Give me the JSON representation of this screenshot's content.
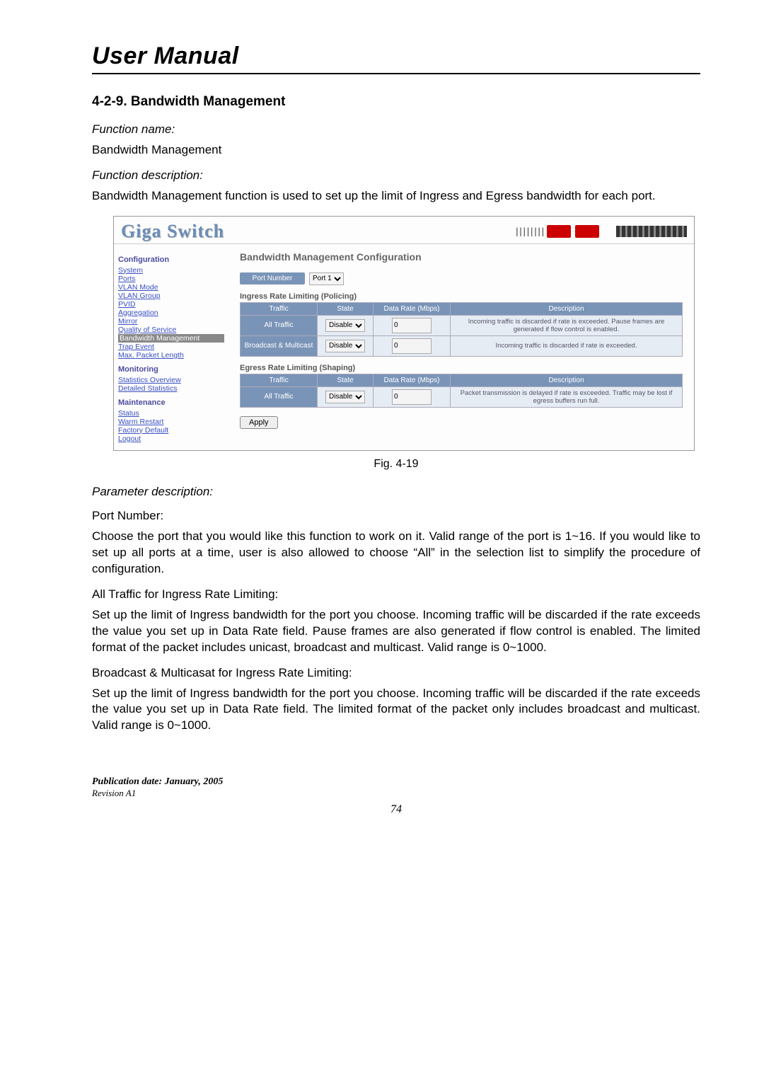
{
  "doc": {
    "title": "User Manual",
    "section_heading": "4-2-9. Bandwidth Management",
    "func_name_label": "Function name:",
    "func_name": "Bandwidth Management",
    "func_desc_label": "Function description:",
    "func_desc": "Bandwidth Management function is used to set up the limit of Ingress and Egress bandwidth for each port.",
    "fig_caption": "Fig. 4-19",
    "param_desc_label": "Parameter description:",
    "params": {
      "port_number_label": "Port Number:",
      "port_number_text": "Choose the port that you would like this function to work on it. Valid range of the port is 1~16.  If you would like to set up all ports at a time, user is also allowed to choose “All” in the selection list to simplify the procedure of configuration.",
      "ingress_all_label": "All Traffic for Ingress Rate Limiting:",
      "ingress_all_text": "Set up the limit of Ingress bandwidth for the port you choose.  Incoming traffic will be discarded if the rate exceeds the value you set up in Data Rate field. Pause frames are also generated if flow control is enabled. The limited format of the packet includes unicast, broadcast and multicast. Valid range is 0~1000.",
      "ingress_bm_label": "Broadcast & Multicasat for Ingress Rate Limiting:",
      "ingress_bm_text": "Set up the limit of Ingress bandwidth for the port you choose.  Incoming traffic will be discarded if the rate exceeds the value you set up in Data Rate field. The limited format of the packet only includes broadcast and multicast. Valid range is 0~1000."
    },
    "footer": {
      "pub": "Publication date: January, 2005",
      "rev": "Revision A1",
      "page": "74"
    }
  },
  "screenshot": {
    "logo": "Giga Switch",
    "main_title": "Bandwidth Management Configuration",
    "sidebar": {
      "config_head": "Configuration",
      "config_items": [
        "System",
        "Ports",
        "VLAN Mode",
        "VLAN Group",
        "PVID",
        "Aggregation",
        "Mirror",
        "Quality of Service",
        "Bandwidth Management",
        "Trap Event",
        "Max. Packet Length"
      ],
      "monitor_head": "Monitoring",
      "monitor_items": [
        "Statistics Overview",
        "Detailed Statistics"
      ],
      "maint_head": "Maintenance",
      "maint_items": [
        "Status",
        "Warm Restart",
        "Factory Default",
        "Logout"
      ]
    },
    "port_number_label": "Port Number",
    "port_number_value": "Port 1",
    "ingress_title": "Ingress Rate Limiting (Policing)",
    "egress_title": "Egress Rate Limiting (Shaping)",
    "headers": {
      "traffic": "Traffic",
      "state": "State",
      "rate": "Data Rate (Mbps)",
      "desc": "Description"
    },
    "ingress_rows": [
      {
        "traffic": "All Traffic",
        "state": "Disable",
        "rate": "0",
        "desc": "Incoming traffic is discarded if rate is exceeded. Pause frames are generated if flow control is enabled."
      },
      {
        "traffic": "Broadcast & Multicast",
        "state": "Disable",
        "rate": "0",
        "desc": "Incoming traffic is discarded if rate is exceeded."
      }
    ],
    "egress_rows": [
      {
        "traffic": "All Traffic",
        "state": "Disable",
        "rate": "0",
        "desc": "Packet transmission is delayed if rate is exceeded. Traffic may be lost if egress buffers run full."
      }
    ],
    "apply": "Apply"
  }
}
